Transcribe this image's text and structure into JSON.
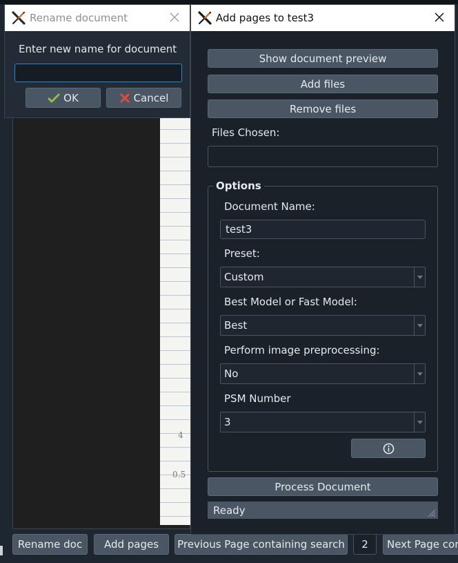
{
  "rename_dialog": {
    "title": "Rename document",
    "prompt": "Enter new name for document",
    "input_value": "",
    "ok_label": "OK",
    "cancel_label": "Cancel"
  },
  "add_pages_dialog": {
    "title": "Add pages to test3",
    "show_preview_label": "Show document preview",
    "add_files_label": "Add files",
    "remove_files_label": "Remove files",
    "files_chosen_label": "Files Chosen:",
    "files_chosen_value": "",
    "options": {
      "group_title": "Options",
      "document_name_label": "Document Name:",
      "document_name_value": "test3",
      "preset_label": "Preset:",
      "preset_value": "Custom",
      "model_label": "Best Model or Fast Model:",
      "model_value": "Best",
      "preprocessing_label": "Perform image preprocessing:",
      "preprocessing_value": "No",
      "psm_label": "PSM Number",
      "psm_value": "3"
    },
    "process_label": "Process Document",
    "status_text": "Ready"
  },
  "main_window": {
    "bottom_bar": {
      "rename_doc_label": "Rename doc",
      "add_pages_label": "Add pages",
      "prev_search_label": "Previous Page containing search",
      "page_number": "2",
      "next_search_label": "Next Page cor"
    },
    "document_scribbles": [
      "4",
      "0.5"
    ]
  },
  "colors": {
    "window_bg": "#1b2129",
    "button_bg": "#4a5663",
    "focus_border": "#2f86c8",
    "titlebar_bg": "#ffffff"
  },
  "icons": {
    "app": "app-x-icon",
    "close": "close-icon",
    "ok": "ok-check-icon",
    "cancel": "cancel-x-icon",
    "info": "info-icon",
    "dropdown": "chevron-down-icon",
    "resize": "resize-grip-icon"
  }
}
